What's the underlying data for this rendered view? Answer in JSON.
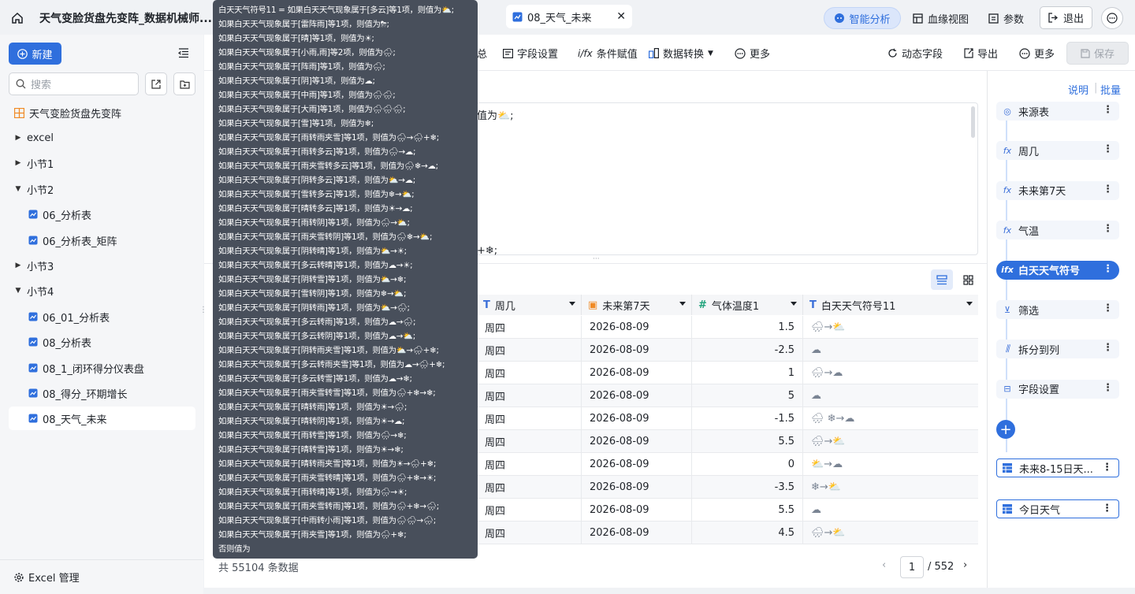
{
  "topbar": {
    "title": "天气变脸货盘先变阵_数据机械师...",
    "tab": "08_天气_未来",
    "smart": "智能分析",
    "lineage": "血缘视图",
    "params": "参数",
    "exit": "退出"
  },
  "sidebar": {
    "new": "新建",
    "search_placeholder": "搜索",
    "root": "天气变脸货盘先变阵",
    "items": [
      {
        "label": "excel",
        "caret": "▶"
      },
      {
        "label": "小节1",
        "caret": "▶"
      },
      {
        "label": "小节2",
        "caret": "▼"
      },
      {
        "label": "06_分析表"
      },
      {
        "label": "06_分析表_矩阵"
      },
      {
        "label": "小节3",
        "caret": "▶"
      },
      {
        "label": "小节4",
        "caret": "▼"
      },
      {
        "label": "06_01_分析表"
      },
      {
        "label": "08_分析表"
      },
      {
        "label": "08_1_闭环得分仪表盘"
      },
      {
        "label": "08_得分_环期增长"
      },
      {
        "label": "08_天气_未来"
      }
    ],
    "excel_mgr": "Excel 管理"
  },
  "toolbar": {
    "summary_tail": "总",
    "field_settings": "字段设置",
    "conditional": "条件赋值",
    "transform": "数据转换",
    "more": "更多",
    "dynamic": "动态字段",
    "export": "导出",
    "more2": "更多",
    "save": "保存"
  },
  "editor": {
    "line1_tail": "值为⛅;",
    "last_tail": "+❄;"
  },
  "table": {
    "headers": [
      "周几",
      "未来第7天",
      "气体温度1",
      "白天天气符号11"
    ],
    "rows": [
      [
        "周四",
        "2026-08-09",
        "1.5",
        "🌧→⛅"
      ],
      [
        "周四",
        "2026-08-09",
        "-2.5",
        "☁"
      ],
      [
        "周四",
        "2026-08-09",
        "1",
        "🌧→☁"
      ],
      [
        "周四",
        "2026-08-09",
        "5",
        "☁"
      ],
      [
        "周四",
        "2026-08-09",
        "-1.5",
        "🌧 ❄→☁"
      ],
      [
        "周四",
        "2026-08-09",
        "5.5",
        "🌧→⛅"
      ],
      [
        "周四",
        "2026-08-09",
        "0",
        "⛅→☁"
      ],
      [
        "周四",
        "2026-08-09",
        "-3.5",
        "❄→⛅"
      ],
      [
        "周四",
        "2026-08-09",
        "5.5",
        "☁"
      ],
      [
        "周四",
        "2026-08-09",
        "4.5",
        "🌧→⛅"
      ]
    ],
    "footer_count": "共 55104 条数据",
    "page": "1",
    "total_pages": "/ 552"
  },
  "pipeline": {
    "explain": "说明",
    "batch": "批量",
    "steps": [
      "来源表",
      "周几",
      "未来第7天",
      "气温",
      "白天天气符号",
      "筛选",
      "拆分到列",
      "字段设置"
    ],
    "step_icons": [
      "◎",
      "fx",
      "fx",
      "fx",
      "ifx",
      "⊻",
      "⫼",
      "⊟"
    ],
    "sources": [
      "未来8-15日天...",
      "今日天气"
    ]
  },
  "tooltip": [
    "白天天气符号11 = 如果白天天气现象属于[多云]等1项，则值为⛅;",
    "如果白天天气现象属于[雷阵雨]等1项，则值为⛈;",
    "如果白天天气现象属于[晴]等1项，则值为☀;",
    "如果白天天气现象属于[小雨,雨]等2项，则值为🌧;",
    "如果白天天气现象属于[阵雨]等1项，则值为🌧;",
    "如果白天天气现象属于[阴]等1项，则值为☁;",
    "如果白天天气现象属于[中雨]等1项，则值为🌧🌧;",
    "如果白天天气现象属于[大雨]等1项，则值为🌧🌧🌧;",
    "如果白天天气现象属于[雪]等1项，则值为❄;",
    "如果白天天气现象属于[雨转雨夹雪]等1项，则值为🌧→🌧+❄;",
    "如果白天天气现象属于[雨转多云]等1项，则值为🌧→☁;",
    "如果白天天气现象属于[雨夹雪转多云]等1项，则值为🌧❄→☁;",
    "如果白天天气现象属于[阴转多云]等1项，则值为⛅→☁;",
    "如果白天天气现象属于[雪转多云]等1项，则值为❄→⛅;",
    "如果白天天气现象属于[晴转多云]等1项，则值为☀→☁;",
    "如果白天天气现象属于[雨转阴]等1项，则值为🌧→⛅;",
    "如果白天天气现象属于[雨夹雪转阴]等1项，则值为🌧❄→⛅;",
    "如果白天天气现象属于[阴转晴]等1项，则值为⛅→☀;",
    "如果白天天气现象属于[多云转晴]等1项，则值为☁→☀;",
    "如果白天天气现象属于[阴转雪]等1项，则值为⛅→❄;",
    "如果白天天气现象属于[雪转阴]等1项，则值为❄→⛅;",
    "如果白天天气现象属于[阴转雨]等1项，则值为⛅→🌧;",
    "如果白天天气现象属于[多云转雨]等1项，则值为☁→🌧;",
    "如果白天天气现象属于[多云转阴]等1项，则值为☁→⛅;",
    "如果白天天气现象属于[阴转雨夹雪]等1项，则值为⛅→🌧+❄;",
    "如果白天天气现象属于[多云转雨夹雪]等1项，则值为☁→🌧+❄;",
    "如果白天天气现象属于[多云转雪]等1项，则值为☁→❄;",
    "如果白天天气现象属于[雨夹雪转雪]等1项，则值为🌧+❄→❄;",
    "如果白天天气现象属于[晴转雨]等1项，则值为☀→🌧;",
    "如果白天天气现象属于[晴转阴]等1项，则值为☀→☁;",
    "如果白天天气现象属于[雨转雪]等1项，则值为🌧→❄;",
    "如果白天天气现象属于[晴转雪]等1项，则值为☀→❄;",
    "如果白天天气现象属于[晴转雨夹雪]等1项，则值为☀→🌧+❄;",
    "如果白天天气现象属于[雨夹雪转晴]等1项，则值为🌧+❄→☀;",
    "如果白天天气现象属于[雨转晴]等1项，则值为🌧→☀;",
    "如果白天天气现象属于[雨夹雪转雨]等1项，则值为🌧+❄→🌧;",
    "如果白天天气现象属于[中雨转小雨]等1项，则值为🌧🌧→🌧;",
    "如果白天天气现象属于[雨夹雪]等1项，则值为🌧+❄;",
    "否则值为"
  ]
}
